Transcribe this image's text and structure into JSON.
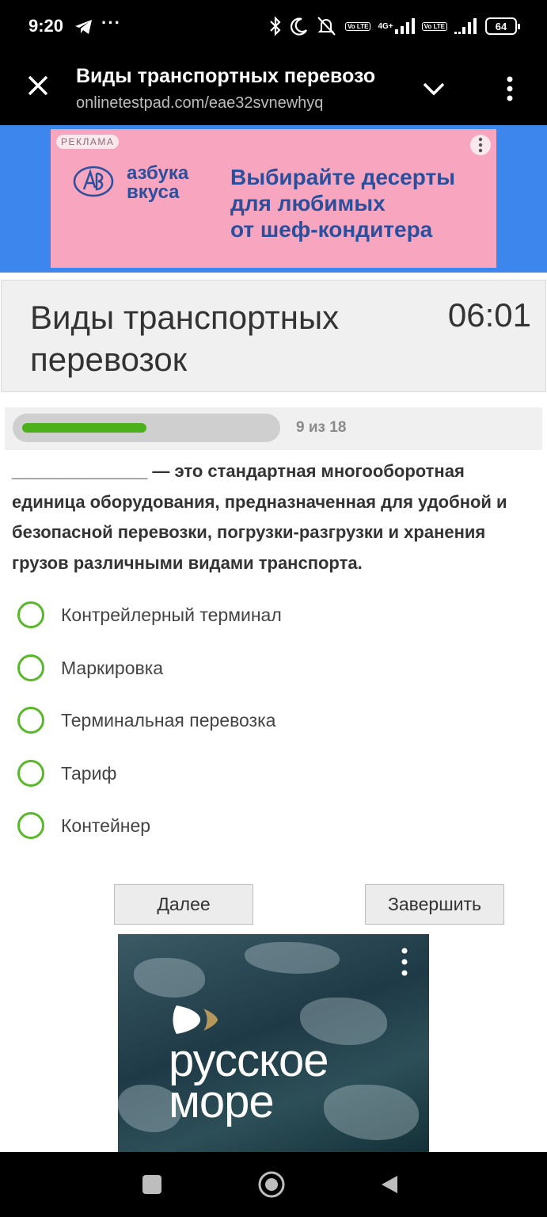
{
  "status_bar": {
    "time": "9:20",
    "more_dots": "···",
    "network_label": "4G+",
    "volte_label": "Vo LTE",
    "battery": "64",
    "icons": [
      "telegram-icon",
      "bluetooth-icon",
      "moon-icon",
      "mute-icon",
      "signal-icon",
      "battery-icon"
    ]
  },
  "browser": {
    "title": "Виды транспортных перевозо",
    "url": "onlinetestpad.com/eae32svnewhyq",
    "icons": [
      "close-icon",
      "chevron-down-icon",
      "more-vert-icon"
    ]
  },
  "ad_top": {
    "label": "РЕКЛАМА",
    "brand_line1": "азбука",
    "brand_line2": "вкуса",
    "slogan_line1": "Выбирайте десерты",
    "slogan_line2": "для любимых",
    "slogan_line3": "от шеф-кондитера",
    "background": "#f8a6bf",
    "frame_color": "#3c86ed"
  },
  "test": {
    "title": "Виды транспортных перевозок",
    "timer": "06:01",
    "progress": {
      "current": 9,
      "total": 18,
      "label": "9 из 18"
    },
    "question": "______________ — это стандартная многооборотная единица оборудования, предназначенная для удобной и безопасной перевозки, погрузки-разгрузки и хранения грузов различными видами транспорта.",
    "answers": [
      "Контрейлерный терминал",
      "Маркировка",
      "Терминальная перевозка",
      "Тариф",
      "Контейнер"
    ],
    "next_label": "Далее",
    "finish_label": "Завершить",
    "accent": "#59b82a"
  },
  "ad_bottom": {
    "text_line1": "русское",
    "text_line2": "море"
  },
  "nav": {
    "icons": [
      "recent-apps-icon",
      "home-icon",
      "back-icon"
    ]
  }
}
